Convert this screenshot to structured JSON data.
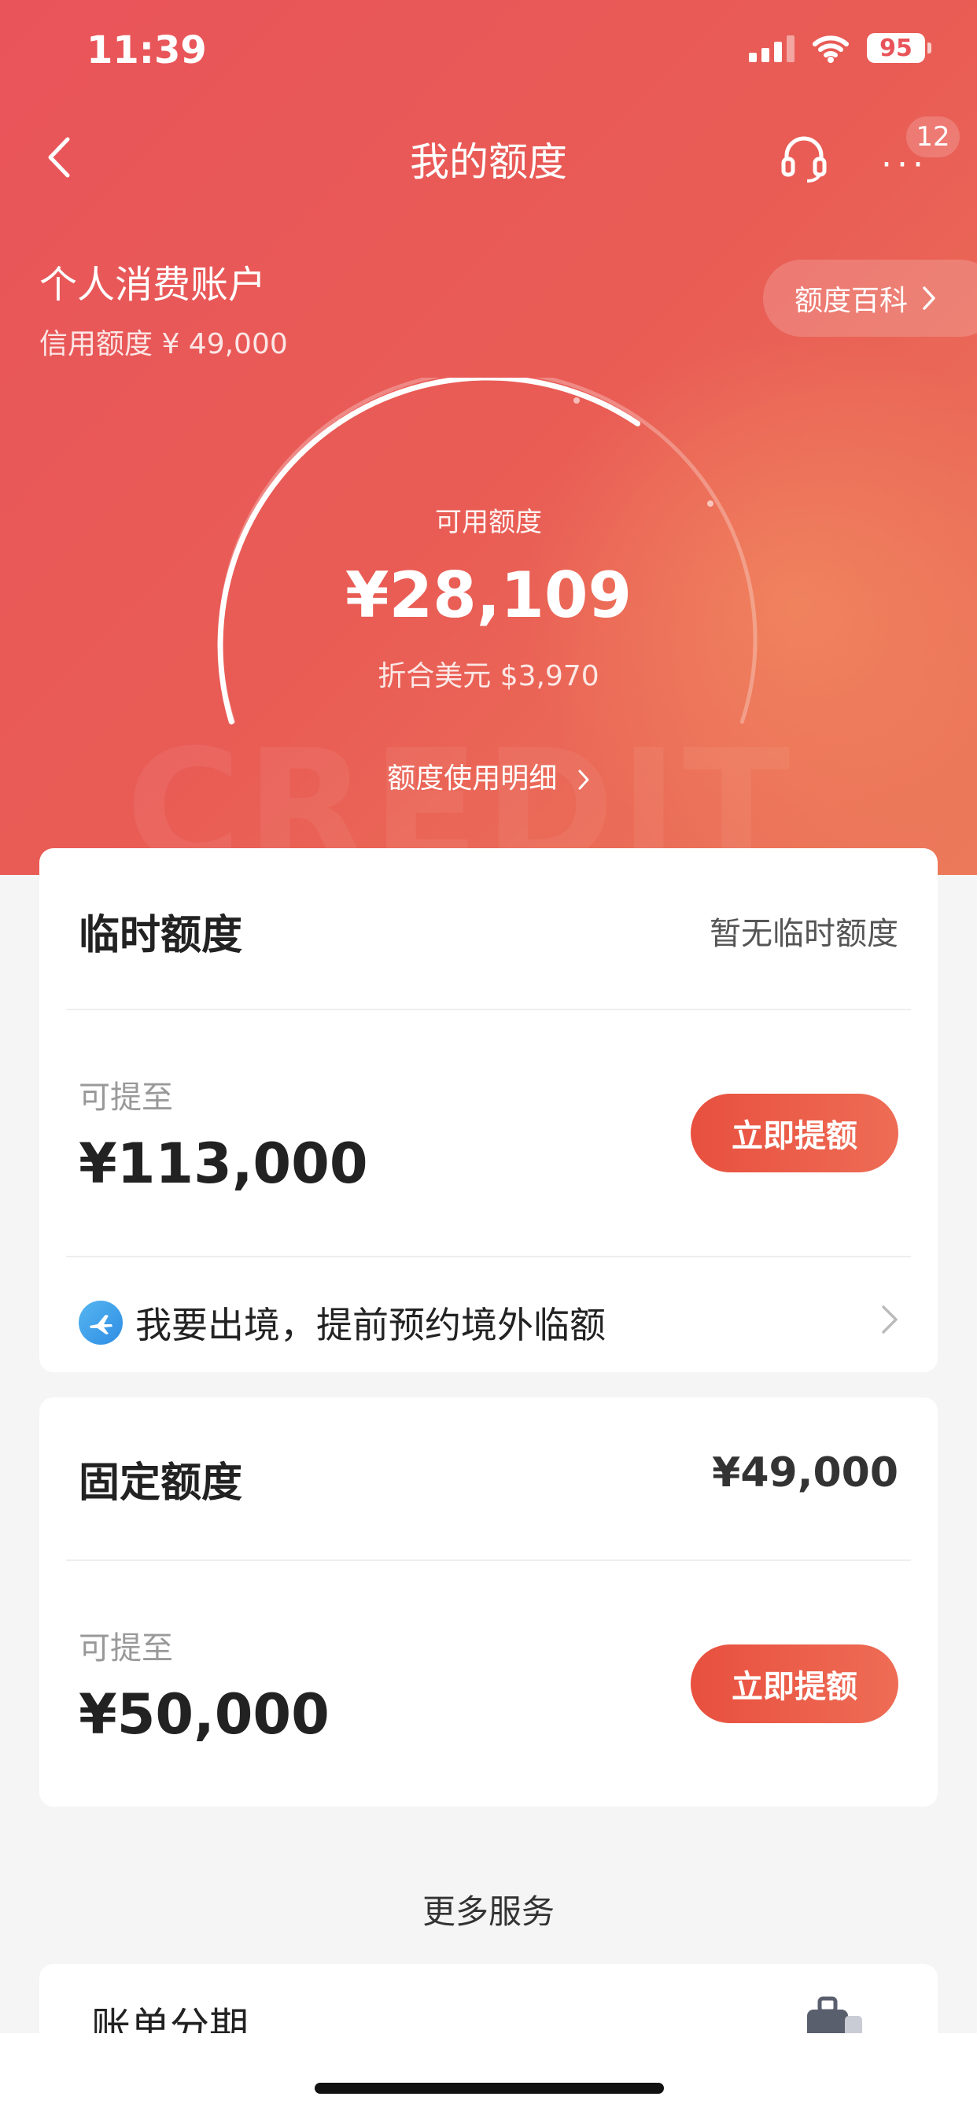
{
  "status_bar": {
    "time": "11:39",
    "battery": "95"
  },
  "nav": {
    "title": "我的额度",
    "badge": "12",
    "more": "···"
  },
  "account": {
    "name": "个人消费账户",
    "credit_limit": "信用额度 ¥ 49,000",
    "wiki_label": "额度百科"
  },
  "available": {
    "label": "可用额度",
    "amount": "¥28,109",
    "usd": "折合美元 $3,970",
    "usage_link": "额度使用明细",
    "used_fraction": 0.43
  },
  "temp_limit": {
    "title": "临时额度",
    "status": "暂无临时额度",
    "raise_label": "可提至",
    "raise_amount": "¥113,000",
    "button": "立即提额",
    "travel_text": "我要出境，提前预约境外临额"
  },
  "fixed_limit": {
    "title": "固定额度",
    "amount": "¥49,000",
    "raise_label": "可提至",
    "raise_amount": "¥50,000",
    "button": "立即提额"
  },
  "more_services": {
    "title": "更多服务",
    "installment": "账单分期"
  },
  "colors": {
    "brand_red": "#e9545a",
    "button_red": "#e8503f"
  }
}
